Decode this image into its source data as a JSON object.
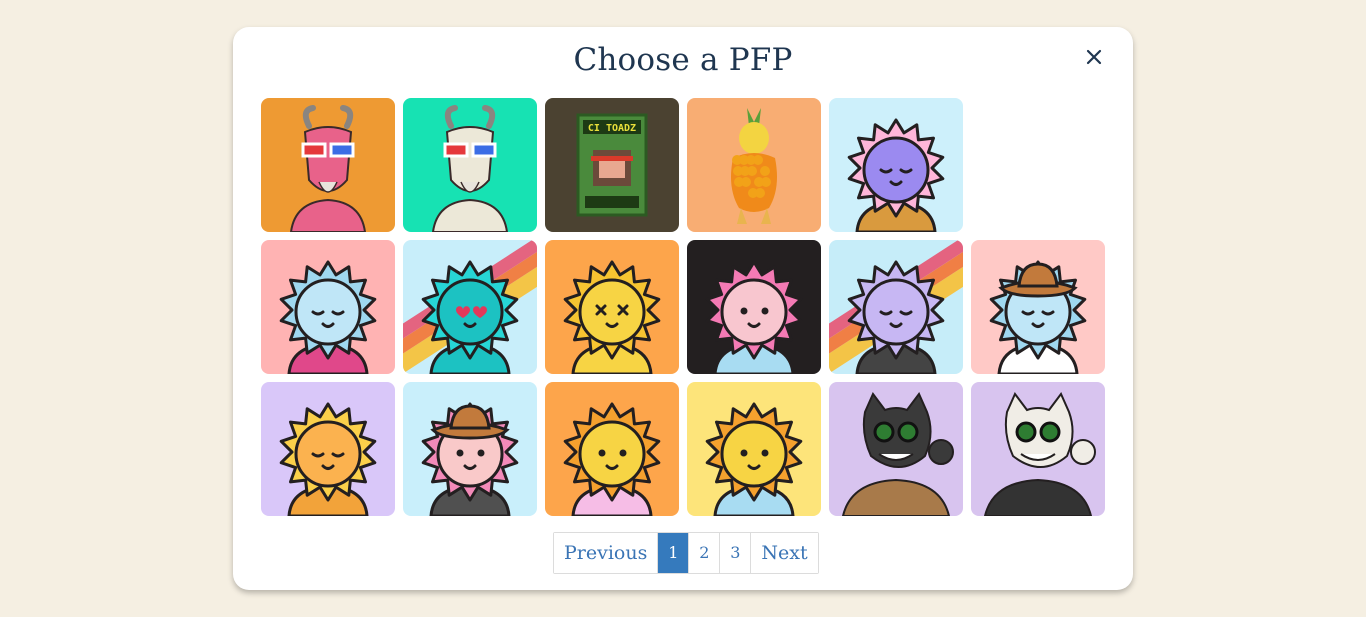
{
  "modal": {
    "title": "Choose a PFP",
    "close_label": "×"
  },
  "pfp_grid": {
    "items": [
      {
        "id": "goat-pink",
        "bg": "#ee9a33",
        "kind": "goat",
        "color": "#e8628a"
      },
      {
        "id": "goat-white",
        "bg": "#17e2b3",
        "kind": "goat",
        "color": "#ece8d8"
      },
      {
        "id": "cryptoadz",
        "bg": "#4b4231",
        "kind": "toadz"
      },
      {
        "id": "pineapple",
        "bg": "#f8ad73",
        "kind": "fruit"
      },
      {
        "id": "sun-gradient-overalls",
        "bg": "#cdf0fb",
        "kind": "sun",
        "face": "#9b8af0",
        "petal": "#ffb6d9",
        "shirt": "#d99a3e",
        "eyes": "closed"
      },
      {
        "id": "sun-pink-rings",
        "bg": "#ffb3b3",
        "kind": "sun",
        "face": "#bfe6f7",
        "petal": "#9fd8f0",
        "shirt": "#e0488a",
        "eyes": "closed"
      },
      {
        "id": "sun-rainbow-teal",
        "bg": "#c8eefa",
        "kind": "sun",
        "face": "#1cc2c2",
        "petal": "#27d6d6",
        "shirt": "#1cc2c2",
        "eyes": "hearts",
        "rainbow": true
      },
      {
        "id": "sun-yellow-x",
        "bg": "#fda54b",
        "kind": "sun",
        "face": "#f7d444",
        "petal": "#f7c431",
        "shirt": "#f7d444",
        "eyes": "x"
      },
      {
        "id": "sun-pink-hoodie",
        "bg": "#231f20",
        "kind": "sun",
        "face": "#f8c6cf",
        "petal": "#f47ab4",
        "shirt": "#a8dcf2",
        "eyes": "open"
      },
      {
        "id": "sun-lilac-rainbow",
        "bg": "#c6edf9",
        "kind": "sun",
        "face": "#c7b7f3",
        "petal": "#c7b7f3",
        "shirt": "#444",
        "eyes": "closed",
        "rainbow": true
      },
      {
        "id": "sun-cowboy-blue",
        "bg": "#ffc9c6",
        "kind": "sun",
        "face": "#bfe6f7",
        "petal": "#9fd8f0",
        "shirt": "#ffffff",
        "eyes": "closed",
        "hat": true
      },
      {
        "id": "sun-fire-mouth",
        "bg": "#d9c7f9",
        "kind": "sun",
        "face": "#fbb24f",
        "petal": "#fbd04a",
        "shirt": "#f2a33a",
        "eyes": "closed"
      },
      {
        "id": "sun-cowboy-pink",
        "bg": "#c9effb",
        "kind": "sun",
        "face": "#f9c9c9",
        "petal": "#f38ab9",
        "shirt": "#505050",
        "eyes": "open",
        "hat": true
      },
      {
        "id": "sun-kimono",
        "bg": "#fda54b",
        "kind": "sun",
        "face": "#f7d444",
        "petal": "#f5a12e",
        "shirt": "#f6bde6",
        "eyes": "open"
      },
      {
        "id": "sun-overalls-yellow",
        "bg": "#fde47a",
        "kind": "sun",
        "face": "#f7d444",
        "petal": "#f5a12e",
        "shirt": "#a8dcf2",
        "eyes": "open"
      },
      {
        "id": "cat-black-jacket",
        "bg": "#d8c4ef",
        "kind": "cat",
        "face": "#3a3a3a",
        "shirt": "#a87a4a"
      },
      {
        "id": "cat-sailor",
        "bg": "#d8c4ef",
        "kind": "cat",
        "face": "#f0ede6",
        "shirt": "#333"
      }
    ]
  },
  "pagination": {
    "previous": "Previous",
    "pages": [
      "1",
      "2",
      "3"
    ],
    "active_page": "1",
    "next": "Next"
  }
}
